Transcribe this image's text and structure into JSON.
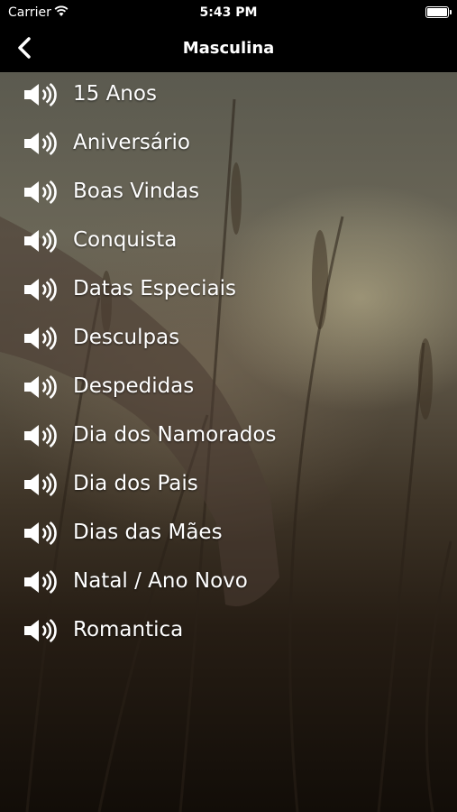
{
  "status_bar": {
    "carrier": "Carrier",
    "time": "5:43 PM"
  },
  "nav": {
    "title": "Masculina",
    "back_icon": "chevron-left-icon"
  },
  "items": [
    {
      "label": "15 Anos"
    },
    {
      "label": "Aniversário"
    },
    {
      "label": "Boas Vindas"
    },
    {
      "label": "Conquista"
    },
    {
      "label": "Datas Especiais"
    },
    {
      "label": "Desculpas"
    },
    {
      "label": "Despedidas"
    },
    {
      "label": "Dia dos Namorados"
    },
    {
      "label": "Dia dos Pais"
    },
    {
      "label": "Dias das Mães"
    },
    {
      "label": "Natal / Ano Novo"
    },
    {
      "label": "Romantica"
    }
  ],
  "item_icon": "speaker-icon"
}
